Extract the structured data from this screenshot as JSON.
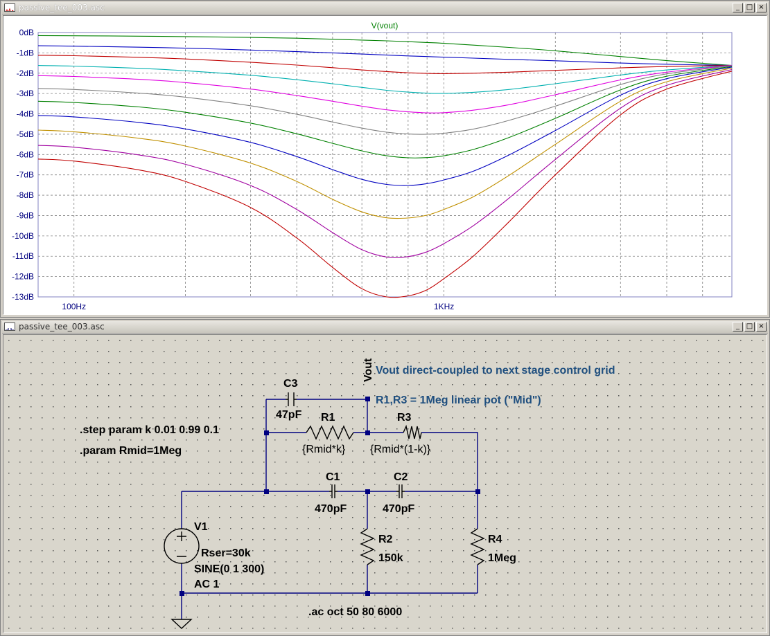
{
  "plot_window": {
    "title": "passive_tee_003.asc",
    "buttons": [
      "_",
      "□",
      "×"
    ]
  },
  "schematic_window": {
    "title": "passive_tee_003.asc",
    "buttons": [
      "_",
      "□",
      "×"
    ]
  },
  "colors": {
    "plot_bg": "#ffffff",
    "axis_label": "#000080",
    "grid": "#808080",
    "schematic_bg": "#d9d6cc",
    "wire": "#000080",
    "component": "#000000",
    "comment": "#1f4f7f"
  },
  "chart_data": {
    "type": "line",
    "title": "V(vout)",
    "xlabel": "",
    "ylabel": "",
    "xscale": "log",
    "xlim": [
      80,
      6000
    ],
    "ylim": [
      -13,
      0
    ],
    "x_ticks": [
      {
        "value": 100,
        "label": "100Hz"
      },
      {
        "value": 1000,
        "label": "1KHz"
      }
    ],
    "y_ticks": [
      {
        "value": 0,
        "label": "0dB"
      },
      {
        "value": -1,
        "label": "-1dB"
      },
      {
        "value": -2,
        "label": "-2dB"
      },
      {
        "value": -3,
        "label": "-3dB"
      },
      {
        "value": -4,
        "label": "-4dB"
      },
      {
        "value": -5,
        "label": "-5dB"
      },
      {
        "value": -6,
        "label": "-6dB"
      },
      {
        "value": -7,
        "label": "-7dB"
      },
      {
        "value": -8,
        "label": "-8dB"
      },
      {
        "value": -9,
        "label": "-9dB"
      },
      {
        "value": -10,
        "label": "-10dB"
      },
      {
        "value": -11,
        "label": "-11dB"
      },
      {
        "value": -12,
        "label": "-12dB"
      },
      {
        "value": -13,
        "label": "-13dB"
      }
    ],
    "grid": true,
    "x": [
      80,
      100,
      150,
      200,
      300,
      400,
      500,
      600,
      700,
      800,
      900,
      1000,
      1200,
      1500,
      2000,
      3000,
      4000,
      6000
    ],
    "series": [
      {
        "color": "#008000",
        "values": [
          -0.15,
          -0.16,
          -0.18,
          -0.2,
          -0.24,
          -0.28,
          -0.33,
          -0.37,
          -0.41,
          -0.45,
          -0.49,
          -0.53,
          -0.62,
          -0.73,
          -0.9,
          -1.18,
          -1.38,
          -1.62
        ]
      },
      {
        "color": "#0000c0",
        "values": [
          -0.65,
          -0.67,
          -0.72,
          -0.77,
          -0.86,
          -0.94,
          -1.0,
          -1.06,
          -1.11,
          -1.15,
          -1.18,
          -1.21,
          -1.26,
          -1.32,
          -1.39,
          -1.5,
          -1.56,
          -1.62
        ]
      },
      {
        "color": "#c00000",
        "values": [
          -1.12,
          -1.14,
          -1.22,
          -1.3,
          -1.46,
          -1.6,
          -1.73,
          -1.84,
          -1.92,
          -1.98,
          -2.01,
          -2.02,
          -2.0,
          -1.95,
          -1.86,
          -1.74,
          -1.67,
          -1.62
        ]
      },
      {
        "color": "#00b0b0",
        "values": [
          -1.62,
          -1.65,
          -1.76,
          -1.88,
          -2.1,
          -2.32,
          -2.52,
          -2.7,
          -2.84,
          -2.93,
          -2.98,
          -2.99,
          -2.94,
          -2.8,
          -2.52,
          -2.09,
          -1.84,
          -1.62
        ]
      },
      {
        "color": "#e000e0",
        "values": [
          -2.12,
          -2.16,
          -2.3,
          -2.46,
          -2.78,
          -3.1,
          -3.38,
          -3.62,
          -3.8,
          -3.9,
          -3.95,
          -3.94,
          -3.82,
          -3.55,
          -3.06,
          -2.33,
          -1.95,
          -1.62
        ]
      },
      {
        "color": "#808080",
        "values": [
          -2.75,
          -2.8,
          -2.98,
          -3.18,
          -3.6,
          -4.02,
          -4.4,
          -4.7,
          -4.9,
          -4.99,
          -5.0,
          -4.95,
          -4.75,
          -4.32,
          -3.62,
          -2.56,
          -2.03,
          -1.64
        ]
      },
      {
        "color": "#008000",
        "values": [
          -3.38,
          -3.44,
          -3.66,
          -3.92,
          -4.45,
          -4.98,
          -5.45,
          -5.82,
          -6.06,
          -6.16,
          -6.15,
          -6.06,
          -5.75,
          -5.16,
          -4.22,
          -2.82,
          -2.15,
          -1.67
        ]
      },
      {
        "color": "#0000c0",
        "values": [
          -4.08,
          -4.15,
          -4.42,
          -4.74,
          -5.4,
          -6.1,
          -6.74,
          -7.22,
          -7.47,
          -7.52,
          -7.43,
          -7.25,
          -6.82,
          -6.02,
          -4.82,
          -3.08,
          -2.27,
          -1.7
        ]
      },
      {
        "color": "#c09000",
        "values": [
          -4.8,
          -4.88,
          -5.2,
          -5.58,
          -6.42,
          -7.32,
          -8.2,
          -8.82,
          -9.11,
          -9.12,
          -8.98,
          -8.7,
          -8.08,
          -7.02,
          -5.5,
          -3.38,
          -2.42,
          -1.75
        ]
      },
      {
        "color": "#a000a0",
        "values": [
          -5.55,
          -5.64,
          -6.02,
          -6.48,
          -7.52,
          -8.7,
          -9.84,
          -10.68,
          -11.04,
          -11.02,
          -10.78,
          -10.38,
          -9.5,
          -8.14,
          -6.24,
          -3.72,
          -2.6,
          -1.82
        ]
      },
      {
        "color": "#c00000",
        "values": [
          -6.22,
          -6.32,
          -6.76,
          -7.32,
          -8.6,
          -10.1,
          -11.55,
          -12.6,
          -13.0,
          -12.95,
          -12.65,
          -12.1,
          -11.0,
          -9.3,
          -7.0,
          -4.05,
          -2.78,
          -1.9
        ]
      }
    ]
  },
  "schematic": {
    "net_label_vout": "Vout",
    "comment_vout": "Vout direct-coupled to next stage control grid",
    "comment_pot": "R1,R3 = 1Meg linear pot (\"Mid\")",
    "directive_step": ".step param k 0.01 0.99 0.1",
    "directive_param": ".param Rmid=1Meg",
    "directive_ac": ".ac oct 50 80 6000",
    "c3_name": "C3",
    "c3_value": "47pF",
    "r1_name": "R1",
    "r1_value": "{Rmid*k}",
    "r3_name": "R3",
    "r3_value": "{Rmid*(1-k)}",
    "c1_name": "C1",
    "c1_value": "470pF",
    "c2_name": "C2",
    "c2_value": "470pF",
    "r2_name": "R2",
    "r2_value": "150k",
    "r4_name": "R4",
    "r4_value": "1Meg",
    "v1_name": "V1",
    "v1_rser": "Rser=30k",
    "v1_sine": "SINE(0 1 300)",
    "v1_ac": "AC 1"
  }
}
